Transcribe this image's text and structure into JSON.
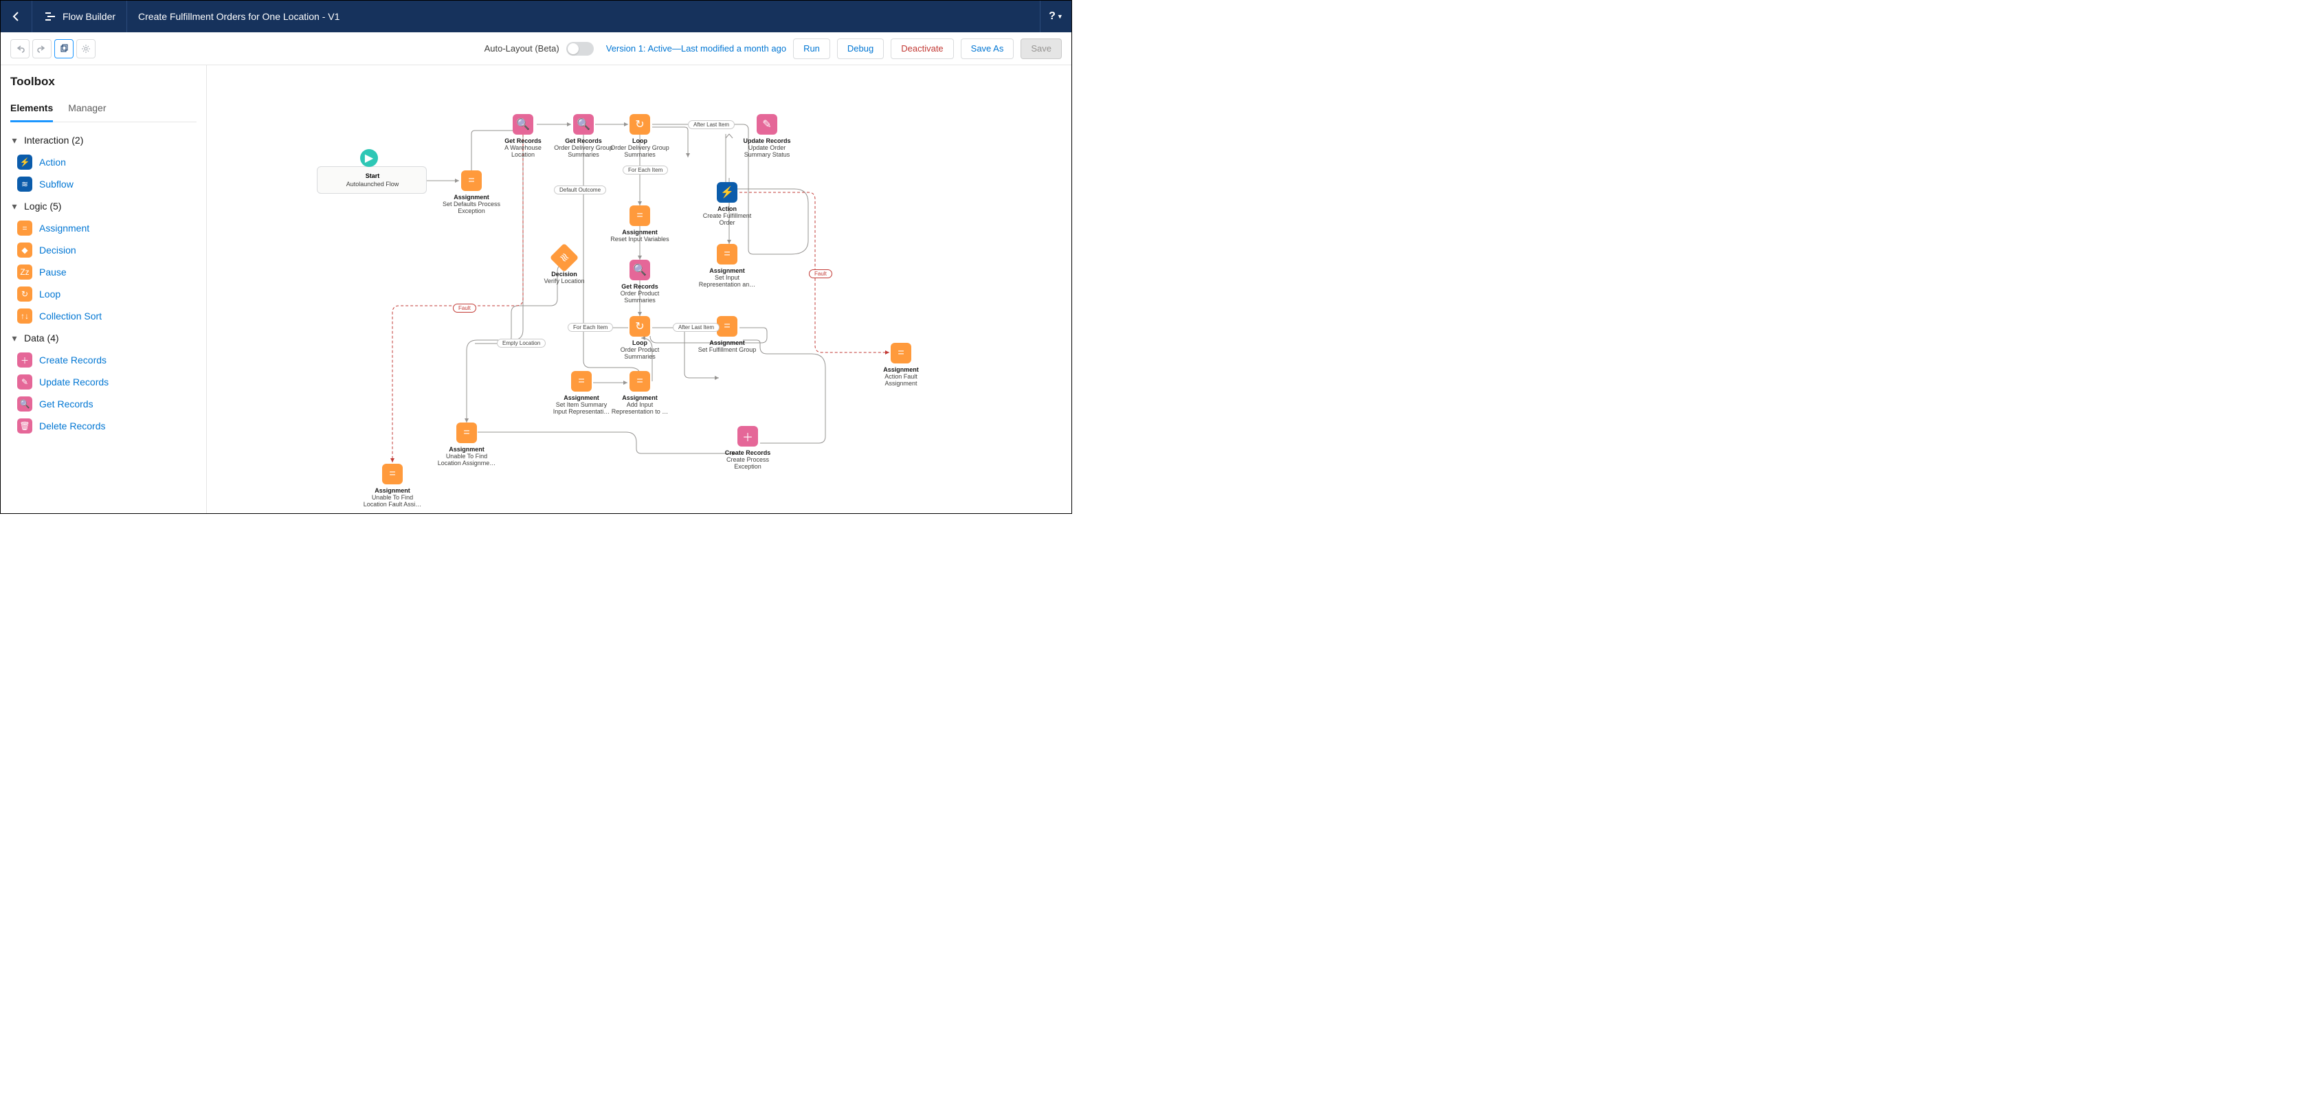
{
  "header": {
    "app_name": "Flow Builder",
    "breadcrumb": "Create Fulfillment Orders for One Location - V1",
    "help": "?"
  },
  "toolbar": {
    "auto_layout_label": "Auto-Layout (Beta)",
    "version_text": "Version 1: Active—Last modified a month ago",
    "run": "Run",
    "debug": "Debug",
    "deactivate": "Deactivate",
    "save_as": "Save As",
    "save": "Save"
  },
  "sidebar": {
    "title": "Toolbox",
    "tabs": {
      "elements": "Elements",
      "manager": "Manager"
    },
    "cat_interaction": "Interaction (2)",
    "cat_logic": "Logic (5)",
    "cat_data": "Data (4)",
    "items": {
      "action": "Action",
      "subflow": "Subflow",
      "assignment": "Assignment",
      "decision": "Decision",
      "pause": "Pause",
      "loop": "Loop",
      "collection_sort": "Collection Sort",
      "create_records": "Create Records",
      "update_records": "Update Records",
      "get_records": "Get Records",
      "delete_records": "Delete Records"
    }
  },
  "canvas": {
    "start": {
      "type": "Start",
      "sub": "Autolaunched Flow"
    },
    "assign_defaults": {
      "type": "Assignment",
      "sub": "Set Defaults Process Exception"
    },
    "get_warehouse": {
      "type": "Get Records",
      "sub": "A Warehouse Location"
    },
    "get_odgs": {
      "type": "Get Records",
      "sub": "Order Delivery Group Summaries"
    },
    "loop_odgs": {
      "type": "Loop",
      "sub": "Order Delivery Group Summaries"
    },
    "update_status": {
      "type": "Update Records",
      "sub": "Update Order Summary Status"
    },
    "decision_verify": {
      "type": "Decision",
      "sub": "Verify Location"
    },
    "assign_reset": {
      "type": "Assignment",
      "sub": "Reset Input Variables"
    },
    "action_cfo": {
      "type": "Action",
      "sub": "Create Fulfillment Order"
    },
    "get_ops": {
      "type": "Get Records",
      "sub": "Order Product Summaries"
    },
    "assign_set_input": {
      "type": "Assignment",
      "sub": "Set Input Representation an…"
    },
    "loop_ops": {
      "type": "Loop",
      "sub": "Order Product Summaries"
    },
    "assign_set_fg": {
      "type": "Assignment",
      "sub": "Set Fulfillment Group"
    },
    "assign_item_sum": {
      "type": "Assignment",
      "sub": "Set Item Summary Input Representati…"
    },
    "assign_add_input": {
      "type": "Assignment",
      "sub": "Add Input Representation to …"
    },
    "assign_unable": {
      "type": "Assignment",
      "sub": "Unable To Find Location Assignme…"
    },
    "assign_unable_fault": {
      "type": "Assignment",
      "sub": "Unable To Find Location Fault Assi…"
    },
    "create_process_exc": {
      "type": "Create Records",
      "sub": "Create Process Exception"
    },
    "assign_action_fault": {
      "type": "Assignment",
      "sub": "Action Fault Assignment"
    },
    "pills": {
      "fault1": "Fault",
      "fault2": "Fault",
      "default_outcome": "Default Outcome",
      "for_each_1": "For Each Item",
      "for_each_2": "For Each Item",
      "after_last_1": "After Last Item",
      "after_last_2": "After Last Item",
      "empty_location": "Empty Location"
    }
  }
}
